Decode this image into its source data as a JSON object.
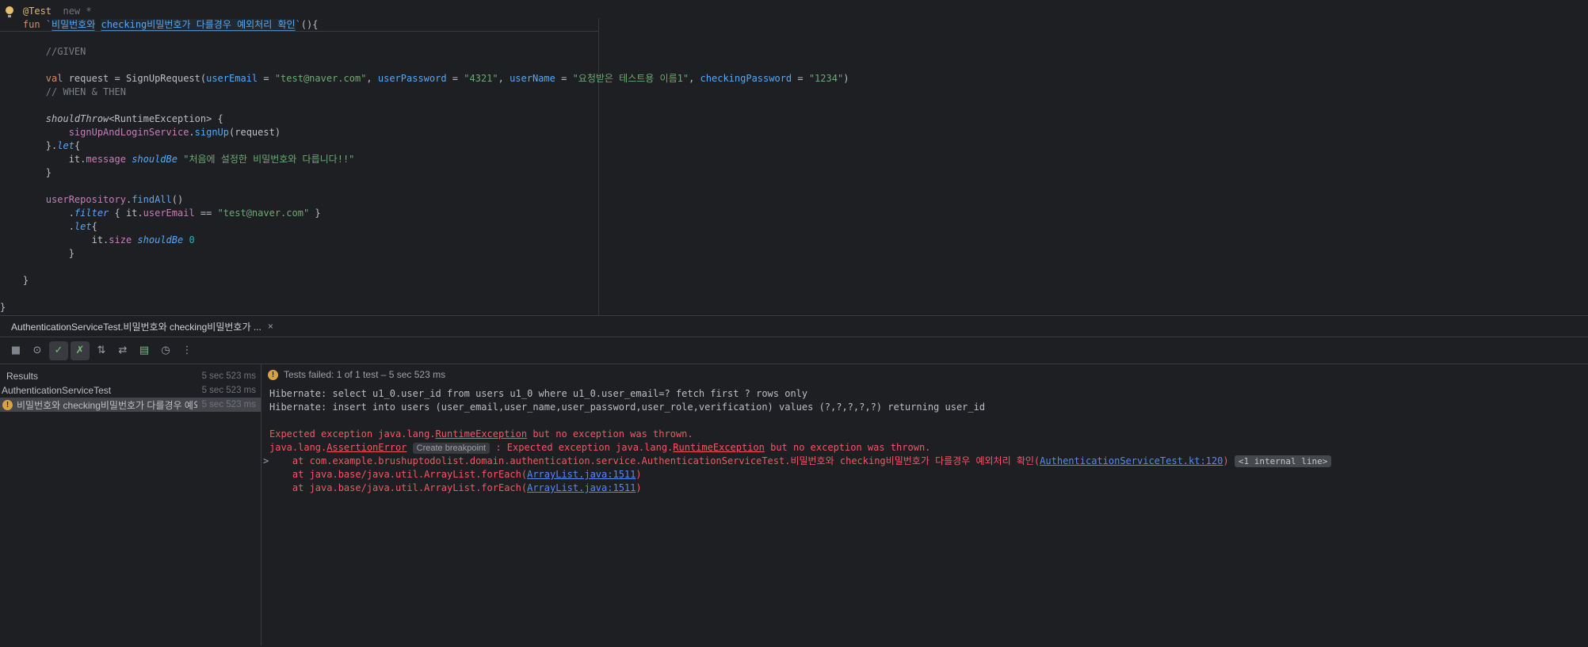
{
  "colors": {
    "editor_bg": "#1E1F22",
    "separator": "#393B40",
    "keyword": "#CF8E6D",
    "string": "#6AAB73",
    "comment": "#7A7E85",
    "property": "#C77DBB",
    "function": "#56A8F5",
    "number": "#2AACB8",
    "annotation": "#D5B778",
    "error_red": "#F75464",
    "link_blue": "#548AF7",
    "warning_orange": "#D9A343",
    "selection_row": "#43454A"
  },
  "editor": {
    "lines": [
      {
        "icon": "bulb",
        "tokens": [
          {
            "t": "    "
          },
          {
            "t": "@Test",
            "s": "ann"
          },
          {
            "t": "  "
          },
          {
            "t": "new *",
            "s": "ghost"
          }
        ]
      },
      {
        "sep": true,
        "tokens": [
          {
            "t": "    "
          },
          {
            "t": "fun ",
            "s": "kw"
          },
          {
            "t": "`",
            "s": "decl"
          },
          {
            "t": "비밀번호와",
            "s": "declbox"
          },
          {
            "t": " "
          },
          {
            "t": "checking비밀번호가 다를경우 예외처리 확인",
            "s": "declbox"
          },
          {
            "t": "`",
            "s": "decl"
          },
          {
            "t": "(){"
          }
        ]
      },
      {
        "tokens": []
      },
      {
        "tokens": [
          {
            "t": "        //GIVEN",
            "s": "cmt"
          }
        ]
      },
      {
        "tokens": []
      },
      {
        "tokens": [
          {
            "t": "        "
          },
          {
            "t": "val",
            "s": "kw"
          },
          {
            "t": " request = SignUpRequest("
          },
          {
            "t": "userEmail",
            "s": "arg"
          },
          {
            "t": " = "
          },
          {
            "t": "\"test@naver.com\"",
            "s": "str"
          },
          {
            "t": ", "
          },
          {
            "t": "userPassword",
            "s": "arg"
          },
          {
            "t": " = "
          },
          {
            "t": "\"4321\"",
            "s": "str"
          },
          {
            "t": ", "
          },
          {
            "t": "userName",
            "s": "arg"
          },
          {
            "t": " = "
          },
          {
            "t": "\"요청받은 테스트용 이름1\"",
            "s": "str"
          },
          {
            "t": ", "
          },
          {
            "t": "checkingPassword",
            "s": "arg"
          },
          {
            "t": " = "
          },
          {
            "t": "\"1234\"",
            "s": "str"
          },
          {
            "t": ")"
          }
        ]
      },
      {
        "tokens": [
          {
            "t": "        // WHEN & THEN",
            "s": "cmt"
          }
        ]
      },
      {
        "tokens": []
      },
      {
        "tokens": [
          {
            "t": "        "
          },
          {
            "t": "shouldThrow",
            "s": "txti"
          },
          {
            "t": "<RuntimeException> {"
          }
        ]
      },
      {
        "tokens": [
          {
            "t": "            "
          },
          {
            "t": "signUpAndLoginService",
            "s": "prop"
          },
          {
            "t": "."
          },
          {
            "t": "signUp",
            "s": "fn"
          },
          {
            "t": "(request)"
          }
        ]
      },
      {
        "tokens": [
          {
            "t": "        }."
          },
          {
            "t": "let",
            "s": "fni"
          },
          {
            "t": "{"
          }
        ]
      },
      {
        "tokens": [
          {
            "t": "            it."
          },
          {
            "t": "message",
            "s": "prop"
          },
          {
            "t": " "
          },
          {
            "t": "shouldBe",
            "s": "fni"
          },
          {
            "t": " "
          },
          {
            "t": "\"처음에 설정한 비밀번호와 다릅니다!!\"",
            "s": "str"
          }
        ]
      },
      {
        "tokens": [
          {
            "t": "        }"
          }
        ]
      },
      {
        "tokens": []
      },
      {
        "tokens": [
          {
            "t": "        "
          },
          {
            "t": "userRepository",
            "s": "prop"
          },
          {
            "t": "."
          },
          {
            "t": "findAll",
            "s": "fn"
          },
          {
            "t": "()"
          }
        ]
      },
      {
        "tokens": [
          {
            "t": "            ."
          },
          {
            "t": "filter",
            "s": "fni"
          },
          {
            "t": " { it."
          },
          {
            "t": "userEmail",
            "s": "prop"
          },
          {
            "t": " == "
          },
          {
            "t": "\"test@naver.com\"",
            "s": "str"
          },
          {
            "t": " }"
          }
        ]
      },
      {
        "tokens": [
          {
            "t": "            ."
          },
          {
            "t": "let",
            "s": "fni"
          },
          {
            "t": "{"
          }
        ]
      },
      {
        "tokens": [
          {
            "t": "                it."
          },
          {
            "t": "size",
            "s": "prop"
          },
          {
            "t": " "
          },
          {
            "t": "shouldBe",
            "s": "fni"
          },
          {
            "t": " "
          },
          {
            "t": "0",
            "s": "num"
          }
        ]
      },
      {
        "tokens": [
          {
            "t": "            }"
          }
        ]
      },
      {
        "tokens": []
      },
      {
        "tokens": [
          {
            "t": "    }"
          }
        ]
      },
      {
        "tokens": []
      },
      {
        "tokens": [
          {
            "t": "}"
          }
        ]
      }
    ]
  },
  "run_panel": {
    "tab": {
      "label": "AuthenticationServiceTest.비밀번호와 checking비밀번호가 ...",
      "close_glyph": "×"
    },
    "toolbar": [
      {
        "name": "stop-icon",
        "glyph": "■",
        "selected": false,
        "color": "#7F848C"
      },
      {
        "name": "show-ignored-icon",
        "glyph": "⊙",
        "selected": false,
        "color": "#9DA0A8"
      },
      {
        "name": "show-passed-icon",
        "glyph": "✓",
        "selected": true,
        "color": "#73BD79"
      },
      {
        "name": "show-failed-icon",
        "glyph": "✗",
        "selected": true,
        "color": "#73BD79"
      },
      {
        "name": "sort-alphabetically-icon",
        "glyph": "⇅",
        "selected": false,
        "color": "#9DA0A8"
      },
      {
        "name": "rerun-failed-tests-icon",
        "glyph": "⇄",
        "selected": false,
        "color": "#9DA0A8"
      },
      {
        "name": "export-test-results-icon",
        "glyph": "▤",
        "selected": false,
        "color": "#73BD79"
      },
      {
        "name": "test-history-icon",
        "glyph": "◷",
        "selected": false,
        "color": "#9DA0A8"
      },
      {
        "name": "more-options-icon",
        "glyph": "⋮",
        "selected": false,
        "color": "#9DA0A8"
      }
    ],
    "tree": [
      {
        "label": "Results",
        "time": "5 sec 523 ms",
        "icon": null,
        "selected": false
      },
      {
        "label": "AuthenticationServiceTest",
        "time": "5 sec 523 ms",
        "icon": null,
        "selected": false
      },
      {
        "label": "비밀번호와 checking비밀번호가 다를경우 예외처리 확인",
        "time": "5 sec 523 ms",
        "icon": "test-error-icon",
        "selected": true
      }
    ],
    "console": {
      "status": "Tests failed: 1 of 1 test – 5 sec 523 ms",
      "status_icon": "!",
      "lines": [
        {
          "tokens": [
            {
              "t": "Hibernate: select u1_0.user_id from users u1_0 where u1_0.user_email=? fetch first ? rows only"
            }
          ]
        },
        {
          "tokens": [
            {
              "t": "Hibernate: insert into users (user_email,user_name,user_password,user_role,verification) values (?,?,?,?,?) returning user_id"
            }
          ]
        },
        {
          "tokens": []
        },
        {
          "tokens": [
            {
              "t": "Expected exception java.lang.",
              "s": "err"
            },
            {
              "t": "RuntimeException",
              "s": "errlink",
              "name": "runtime-exception-link"
            },
            {
              "t": " but no exception was thrown.",
              "s": "err"
            }
          ]
        },
        {
          "tokens": [
            {
              "t": "java.lang.",
              "s": "err"
            },
            {
              "t": "AssertionError",
              "s": "errlink",
              "name": "assertion-error-link"
            },
            {
              "t": " "
            },
            {
              "t": "Create breakpoint",
              "s": "chip",
              "name": "create-breakpoint-chip"
            },
            {
              "t": " : Expected exception java.lang.",
              "s": "err"
            },
            {
              "t": "RuntimeException",
              "s": "errlink",
              "name": "runtime-exception-link"
            },
            {
              "t": " but no exception was thrown.",
              "s": "err"
            }
          ]
        },
        {
          "fold": true,
          "tokens": [
            {
              "t": "    at com.example.brushuptodolist.domain.authentication.service.AuthenticationServiceTest.비밀번호와 checking비밀번호가 다를경우 예외처리 확인(",
              "s": "err"
            },
            {
              "t": "AuthenticationServiceTest.kt:120",
              "s": "link",
              "name": "file-line-link"
            },
            {
              "t": ")",
              "s": "err"
            },
            {
              "t": " "
            },
            {
              "t": "<1 internal line>",
              "s": "chip2",
              "name": "internal-lines-chip"
            }
          ]
        },
        {
          "tokens": [
            {
              "t": "    at java.base/java.util.ArrayList.forEach(",
              "s": "err"
            },
            {
              "t": "ArrayList.java:1511",
              "s": "link",
              "name": "file-line-link"
            },
            {
              "t": ")",
              "s": "err"
            }
          ]
        },
        {
          "tokens": [
            {
              "t": "    at java.base/java.util.ArrayList.forEach(",
              "s": "err"
            },
            {
              "t": "ArrayList.java:1511",
              "s": "link",
              "name": "file-line-link"
            },
            {
              "t": ")",
              "s": "err"
            }
          ]
        }
      ]
    }
  }
}
